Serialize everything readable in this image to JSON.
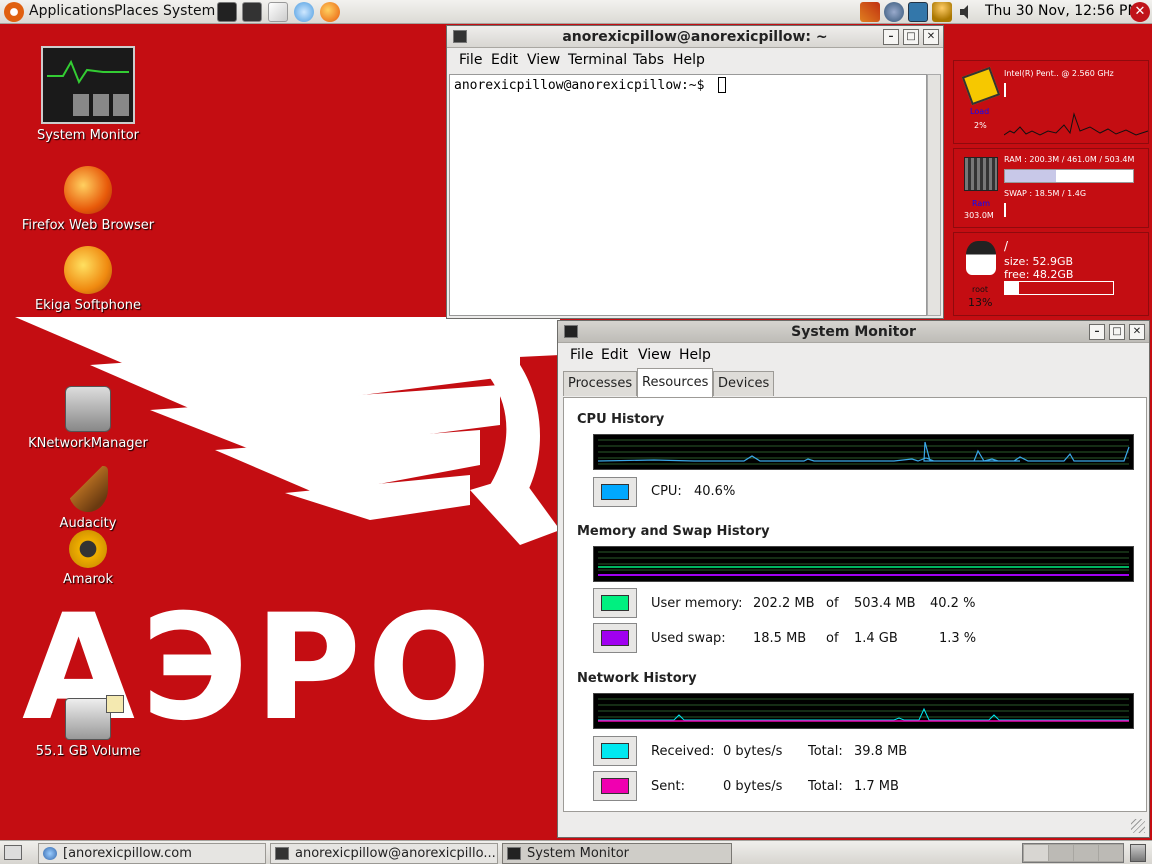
{
  "top_panel": {
    "menus": [
      "Applications",
      "Places",
      "System"
    ],
    "clock": "Thu 30 Nov, 12:56 PM",
    "launcher_icons": [
      "system-monitor-icon",
      "terminal-icon",
      "text-editor-icon",
      "chat-icon",
      "firefox-icon"
    ],
    "tray_icons": [
      "tools-icon",
      "network-icon",
      "updates-icon",
      "user-icon",
      "volume-icon"
    ]
  },
  "desktop": {
    "icons": [
      {
        "label": "System Monitor",
        "icon": "system-monitor-icon"
      },
      {
        "label": "Firefox Web Browser",
        "icon": "firefox-icon"
      },
      {
        "label": "Ekiga Softphone",
        "icon": "ekiga-icon"
      },
      {
        "label": "KNetworkManager",
        "icon": "network-manager-icon"
      },
      {
        "label": "Audacity",
        "icon": "audacity-icon"
      },
      {
        "label": "Amarok",
        "icon": "amarok-icon"
      },
      {
        "label": "55.1 GB Volume",
        "icon": "drive-icon"
      }
    ],
    "wallpaper_text": "АЭРО"
  },
  "terminal": {
    "title": "anorexicpillow@anorexicpillow: ~",
    "menu": [
      "File",
      "Edit",
      "View",
      "Terminal",
      "Tabs",
      "Help"
    ],
    "prompt": "anorexicpillow@anorexicpillow:~$ "
  },
  "widgets": {
    "cpu": {
      "title": "Intel(R) Pent.. @ 2.560 GHz",
      "load_label": "Load",
      "load_value": "2%"
    },
    "ram": {
      "ram_text": "RAM : 200.3M / 461.0M / 503.4M",
      "swap_text": "SWAP : 18.5M / 1.4G",
      "label": "Ram",
      "value": "303.0M",
      "ram_fraction": 0.4
    },
    "disk": {
      "mount": "/",
      "size": "size: 52.9GB",
      "free": "free: 48.2GB",
      "user": "root",
      "used": "13%",
      "used_fraction": 0.13
    }
  },
  "sysmon": {
    "title": "System Monitor",
    "menu": [
      "File",
      "Edit",
      "View",
      "Help"
    ],
    "tabs": [
      "Processes",
      "Resources",
      "Devices"
    ],
    "active_tab": "Resources",
    "cpu_section": "CPU History",
    "cpu": {
      "label": "CPU:",
      "value": "40.6%",
      "color": "#00a8ff"
    },
    "mem_section": "Memory and Swap History",
    "memory": {
      "label": "User memory:",
      "used": "202.2 MB",
      "of": "of",
      "total": "503.4 MB",
      "percent": "40.2 %",
      "color": "#00f080"
    },
    "swap": {
      "label": "Used swap:",
      "used": "18.5 MB",
      "of": "of",
      "total": "1.4 GB",
      "percent": "1.3 %",
      "color": "#a000f0"
    },
    "net_section": "Network History",
    "received": {
      "label": "Received:",
      "rate": "0 bytes/s",
      "total_label": "Total:",
      "total": "39.8 MB",
      "color": "#00e8f0"
    },
    "sent": {
      "label": "Sent:",
      "rate": "0 bytes/s",
      "total_label": "Total:",
      "total": "1.7 MB",
      "color": "#f000b0"
    }
  },
  "taskbar": {
    "tasks": [
      {
        "label": "[anorexicpillow.com",
        "icon": "firefox-icon"
      },
      {
        "label": "anorexicpillow@anorexicpillo...",
        "icon": "terminal-icon"
      },
      {
        "label": "System Monitor",
        "icon": "system-monitor-icon"
      }
    ]
  }
}
